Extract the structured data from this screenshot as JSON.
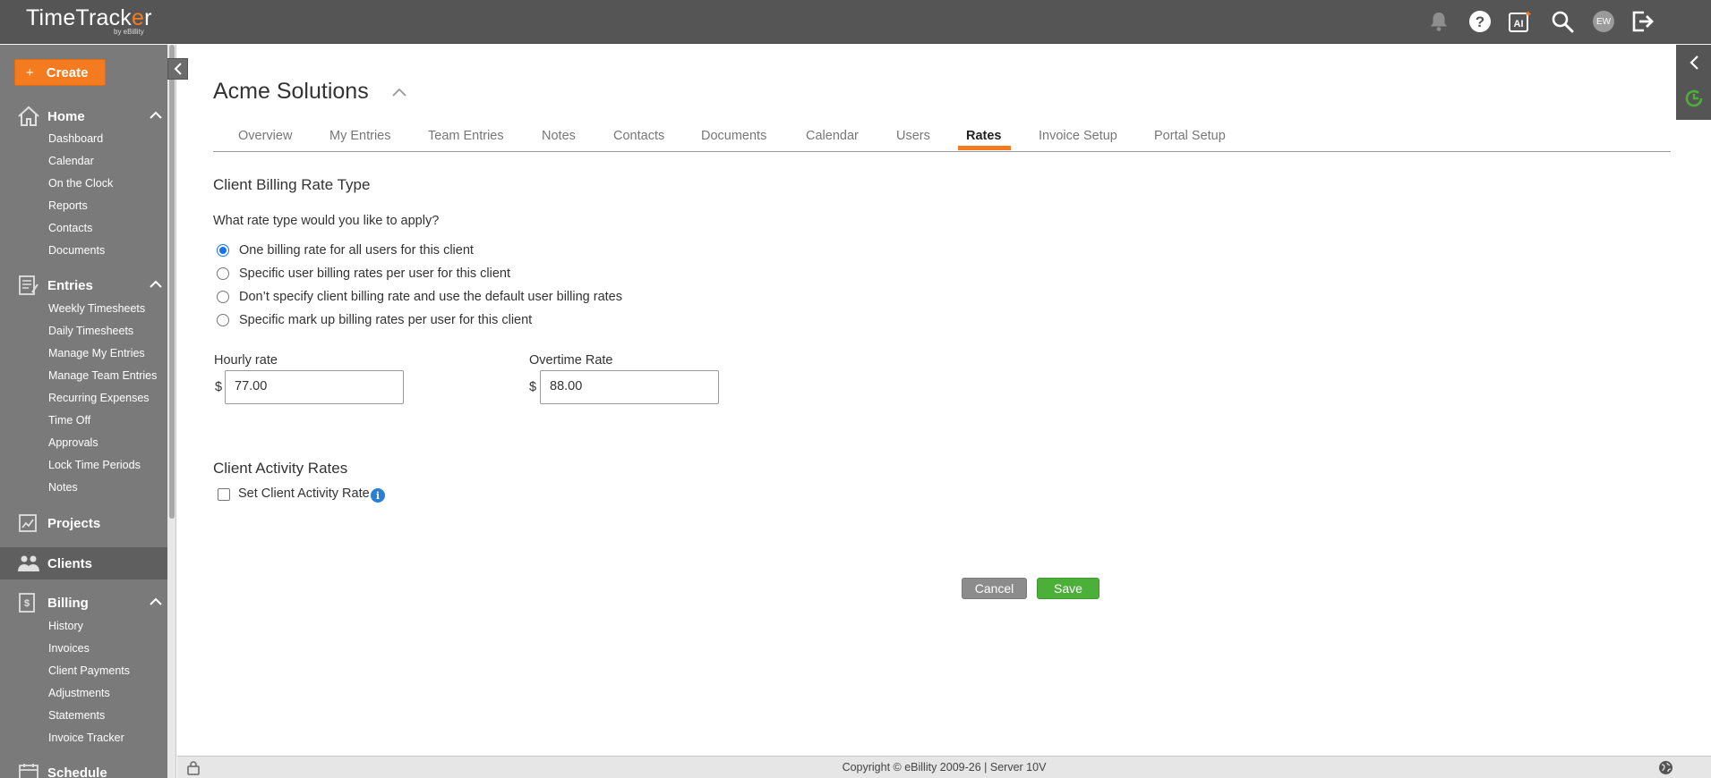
{
  "app": {
    "logo_text_a": "TimeTrack",
    "logo_text_accent": "e",
    "logo_text_b": "r",
    "logo_sub": "by eBillity"
  },
  "topbar": {
    "icons": [
      "bell-icon",
      "help-icon",
      "ai-icon",
      "search-icon",
      "avatar",
      "logout-icon"
    ],
    "avatar_initials": "EW"
  },
  "sidebar": {
    "create_label": "Create",
    "home": {
      "label": "Home",
      "items": [
        "Dashboard",
        "Calendar",
        "On the Clock",
        "Reports",
        "Contacts",
        "Documents"
      ]
    },
    "entries": {
      "label": "Entries",
      "items": [
        "Weekly Timesheets",
        "Daily Timesheets",
        "Manage My Entries",
        "Manage Team Entries",
        "Recurring Expenses",
        "Time Off",
        "Approvals",
        "Lock Time Periods",
        "Notes"
      ]
    },
    "projects": {
      "label": "Projects"
    },
    "clients": {
      "label": "Clients"
    },
    "billing": {
      "label": "Billing",
      "items": [
        "History",
        "Invoices",
        "Client Payments",
        "Adjustments",
        "Statements",
        "Invoice Tracker"
      ]
    },
    "schedule": {
      "label": "Schedule"
    }
  },
  "main": {
    "title": "Acme Solutions",
    "tabs": [
      {
        "label": "Overview"
      },
      {
        "label": "My Entries"
      },
      {
        "label": "Team Entries"
      },
      {
        "label": "Notes"
      },
      {
        "label": "Contacts"
      },
      {
        "label": "Documents"
      },
      {
        "label": "Calendar"
      },
      {
        "label": "Users"
      },
      {
        "label": "Rates"
      },
      {
        "label": "Invoice Setup"
      },
      {
        "label": "Portal Setup"
      }
    ],
    "active_tab": "Rates",
    "billing_section_title": "Client Billing Rate Type",
    "question": "What rate type would you like to apply?",
    "rate_options": [
      "One billing rate for all users for this client",
      "Specific user billing rates per user for this client",
      "Don’t specify client billing rate and use the default user billing rates",
      "Specific mark up billing rates per user for this client"
    ],
    "selected_option": 0,
    "hourly_rate_label": "Hourly rate",
    "hourly_rate_value": "77.00",
    "overtime_rate_label": "Overtime Rate",
    "overtime_rate_value": "88.00",
    "currency_symbol": "$",
    "activity_section_title": "Client Activity Rates",
    "activity_checkbox_label": "Set Client Activity Rate",
    "activity_checkbox_checked": false,
    "cancel_label": "Cancel",
    "save_label": "Save"
  },
  "footer": {
    "text": "Copyright © eBillity 2009-26  |  Server 10V"
  },
  "colors": {
    "accent": "#f47b20",
    "save_green": "#4caf3a",
    "topbar": "#555555",
    "sidebar": "#7a7a7a"
  }
}
